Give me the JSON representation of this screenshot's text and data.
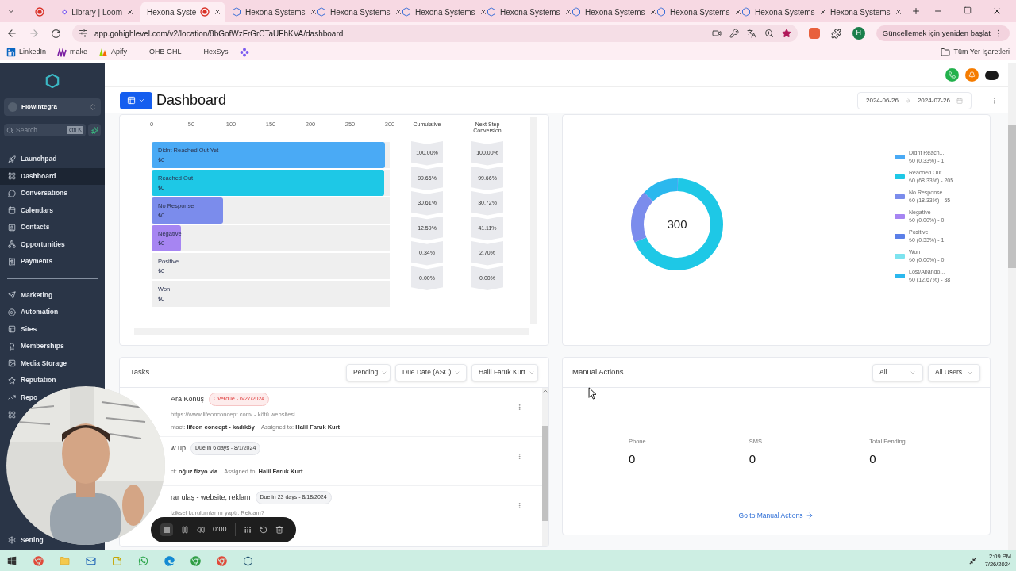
{
  "browser": {
    "tabs": [
      {
        "selected": false,
        "recording": true
      },
      {
        "label": "Library | Loom",
        "selected": false,
        "recording": false
      },
      {
        "label": "Hexona Syste",
        "selected": true,
        "recording": true
      },
      {
        "label": "Hexona Systems",
        "selected": false,
        "recording": false
      },
      {
        "label": "Hexona Systems",
        "selected": false,
        "recording": false
      },
      {
        "label": "Hexona Systems",
        "selected": false,
        "recording": false
      },
      {
        "label": "Hexona Systems",
        "selected": false,
        "recording": false
      },
      {
        "label": "Hexona Systems",
        "selected": false,
        "recording": false
      },
      {
        "label": "Hexona Systems",
        "selected": false,
        "recording": false
      },
      {
        "label": "Hexona Systems",
        "selected": false,
        "recording": false
      },
      {
        "label": "Hexona Systems",
        "selected": false,
        "recording": false
      }
    ],
    "url": "app.gohighlevel.com/v2/location/8bGofWzFrGrCTaUFhKVA/dashboard",
    "profile": "H",
    "update_button": "Güncellemek için yeniden başlat",
    "bookmarks": [
      "LinkedIn",
      "make",
      "Apify",
      "OHB GHL",
      "HexSys"
    ],
    "all_bookmarks": "Tüm Yer İşaretleri"
  },
  "sidebar": {
    "account": "FlowIntegra",
    "search_placeholder": "Search",
    "search_shortcut": "ctrl K",
    "sections": [
      {
        "items": [
          {
            "label": "Launchpad",
            "selected": false
          },
          {
            "label": "Dashboard",
            "selected": true
          },
          {
            "label": "Conversations",
            "selected": false
          },
          {
            "label": "Calendars",
            "selected": false
          },
          {
            "label": "Contacts",
            "selected": false
          },
          {
            "label": "Opportunities",
            "selected": false
          },
          {
            "label": "Payments",
            "selected": false
          }
        ]
      },
      {
        "items": [
          {
            "label": "Marketing",
            "selected": false
          },
          {
            "label": "Automation",
            "selected": false
          },
          {
            "label": "Sites",
            "selected": false
          },
          {
            "label": "Memberships",
            "selected": false
          },
          {
            "label": "Media Storage",
            "selected": false
          },
          {
            "label": "Reputation",
            "selected": false
          },
          {
            "label": "Repo",
            "selected": false
          },
          {
            "selected": false
          }
        ]
      }
    ],
    "settings": "Setting"
  },
  "header": {
    "title": "Dashboard",
    "date_from": "2024-06-26",
    "date_to": "2024-07-26"
  },
  "funnel": {
    "chart_data": {
      "type": "bar",
      "orientation": "horizontal",
      "categories": [
        "Didnt Reached Out Yet",
        "Reached Out",
        "No Response",
        "Negative",
        "Positive",
        "Won"
      ],
      "values": [
        294,
        293,
        90,
        37,
        1,
        0
      ],
      "xlim": [
        0,
        300
      ],
      "xticks": [
        0,
        50,
        100,
        150,
        200,
        250,
        300
      ]
    },
    "amounts": [
      "₺0",
      "₺0",
      "₺0",
      "₺0",
      "₺0",
      "₺0"
    ],
    "columns": [
      {
        "heading": "Cumulative",
        "values": [
          "100.00%",
          "99.66%",
          "30.61%",
          "12.59%",
          "0.34%",
          "0.00%"
        ]
      },
      {
        "heading": "Next Step Conversion",
        "values": [
          "100.00%",
          "99.66%",
          "30.72%",
          "41.11%",
          "2.70%",
          "0.00%"
        ]
      }
    ]
  },
  "donut": {
    "center": "300",
    "chart_data": {
      "type": "donut",
      "categories": [
        "Didnt Reach...",
        "Reached Out...",
        "No Response...",
        "Negative",
        "Positive",
        "Won",
        "Lost/Abando..."
      ],
      "values": [
        0.33,
        68.33,
        18.33,
        0,
        0.33,
        0,
        12.67
      ]
    },
    "legend": [
      {
        "detail": "₺0 (0.33%) - 1",
        "color": "#4aaaf5"
      },
      {
        "detail": "₺0 (68.33%) - 205",
        "color": "#1ec8e6"
      },
      {
        "detail": "₺0 (18.33%) - 55",
        "color": "#7b8cec"
      },
      {
        "detail": "₺0 (0.00%) - 0",
        "color": "#a685f2"
      },
      {
        "detail": "₺0 (0.33%) - 1",
        "color": "#5b7fe8"
      },
      {
        "detail": "₺0 (0.00%) - 0",
        "color": "#7de3ef"
      },
      {
        "detail": "₺0 (12.67%) - 38",
        "color": "#2bb8ee"
      }
    ]
  },
  "tasks": {
    "title": "Tasks",
    "filters": [
      "Pending",
      "Due Date (ASC)",
      "Halil Faruk Kurt"
    ],
    "rows": [
      {
        "title": "Ara Konuş",
        "badge": "Overdue - 6/27/2024",
        "kind": "overdue",
        "description": "https://www.lifeonconcept.com/ - kötü websitesi",
        "contact_label": "ntact:",
        "contact": "lifeon concept - kadıköy",
        "assigned_label": "Assigned to:",
        "assigned": "Halil Faruk Kurt"
      },
      {
        "title": "w up",
        "badge": "Due in 6 days - 8/1/2024",
        "kind": "due",
        "contact_label": "ct:",
        "contact": "oğuz fizyo via",
        "assigned_label": "Assigned to:",
        "assigned": "Halil Faruk Kurt"
      },
      {
        "title": "rar ulaş - website, reklam",
        "badge": "Due in 23 days - 8/18/2024",
        "kind": "due",
        "description": "iziksel kurulumlarını yaptı. Reklam?"
      }
    ]
  },
  "manual_actions": {
    "title": "Manual Actions",
    "filters": [
      "All",
      "All Users"
    ],
    "stats": [
      {
        "label": "Phone",
        "value": "0"
      },
      {
        "label": "SMS",
        "value": "0"
      },
      {
        "label": "Total Pending",
        "value": "0"
      }
    ],
    "link": "Go to Manual Actions"
  },
  "recorder": {
    "time": "0:00"
  },
  "taskbar": {
    "time": "2:09 PM",
    "date": "7/26/2024"
  }
}
